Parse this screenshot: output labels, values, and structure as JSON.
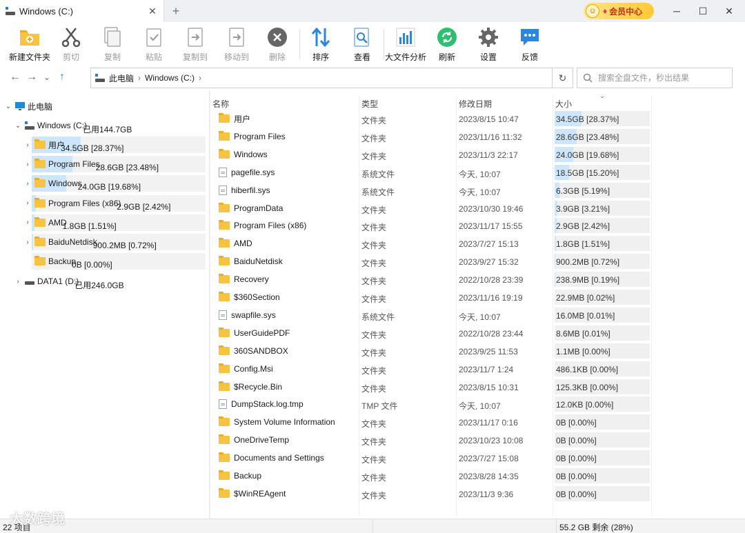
{
  "window": {
    "tab_title": "Windows (C:)",
    "tab_close": "✕",
    "new_tab": "+",
    "vip_label": "会员中心",
    "minimize": "─",
    "maximize": "☐",
    "close": "✕"
  },
  "toolbar": {
    "items": [
      {
        "label": "新建文件夹",
        "icon": "new-folder-icon",
        "enabled": true
      },
      {
        "label": "剪切",
        "icon": "scissors-icon",
        "enabled": false
      },
      {
        "label": "复制",
        "icon": "copy-icon",
        "enabled": false
      },
      {
        "label": "粘贴",
        "icon": "paste-icon",
        "enabled": false
      },
      {
        "label": "复制到",
        "icon": "copy-to-icon",
        "enabled": false
      },
      {
        "label": "移动到",
        "icon": "move-to-icon",
        "enabled": false
      },
      {
        "label": "删除",
        "icon": "delete-icon",
        "enabled": false
      },
      {
        "label": "排序",
        "icon": "sort-icon",
        "enabled": true
      },
      {
        "label": "查看",
        "icon": "view-icon",
        "enabled": true
      },
      {
        "label": "大文件分析",
        "icon": "chart-icon",
        "enabled": true
      },
      {
        "label": "刷新",
        "icon": "refresh-icon",
        "enabled": true
      },
      {
        "label": "设置",
        "icon": "gear-icon",
        "enabled": true
      },
      {
        "label": "反馈",
        "icon": "feedback-icon",
        "enabled": true
      }
    ]
  },
  "address": {
    "crumbs": [
      "此电脑",
      "Windows (C:)"
    ],
    "search_placeholder": "搜索全盘文件，秒出结果"
  },
  "tree": {
    "root": "此电脑",
    "drive_c": {
      "name": "Windows (C:)",
      "size": "已用144.7GB"
    },
    "children": [
      {
        "name": "用户",
        "size": "34.5GB [28.37%]",
        "pct": 28.37
      },
      {
        "name": "Program Files",
        "size": "28.6GB [23.48%]",
        "pct": 23.48
      },
      {
        "name": "Windows",
        "size": "24.0GB [19.68%]",
        "pct": 19.68
      },
      {
        "name": "Program Files (x86)",
        "size": "2.9GB [2.42%]",
        "pct": 2.42
      },
      {
        "name": "AMD",
        "size": "1.8GB [1.51%]",
        "pct": 1.51
      },
      {
        "name": "BaiduNetdisk",
        "size": "900.2MB [0.72%]",
        "pct": 0.72
      },
      {
        "name": "Backup",
        "size": "0B [0.00%]",
        "pct": 0
      }
    ],
    "drive_d": {
      "name": "DATA1 (D:)",
      "size": "已用246.0GB"
    }
  },
  "columns": {
    "name": "名称",
    "type": "类型",
    "date": "修改日期",
    "size": "大小"
  },
  "files": [
    {
      "name": "用户",
      "type": "文件夹",
      "date": "2023/8/15 10:47",
      "size": "34.5GB [28.37%]",
      "pct": 28.37,
      "icon": "folder"
    },
    {
      "name": "Program Files",
      "type": "文件夹",
      "date": "2023/11/16 11:32",
      "size": "28.6GB [23.48%]",
      "pct": 23.48,
      "icon": "folder"
    },
    {
      "name": "Windows",
      "type": "文件夹",
      "date": "2023/11/3 22:17",
      "size": "24.0GB [19.68%]",
      "pct": 19.68,
      "icon": "folder"
    },
    {
      "name": "pagefile.sys",
      "type": "系统文件",
      "date": "今天, 10:07",
      "size": "18.5GB [15.20%]",
      "pct": 15.2,
      "icon": "file"
    },
    {
      "name": "hiberfil.sys",
      "type": "系统文件",
      "date": "今天, 10:07",
      "size": "6.3GB [5.19%]",
      "pct": 5.19,
      "icon": "file"
    },
    {
      "name": "ProgramData",
      "type": "文件夹",
      "date": "2023/10/30 19:46",
      "size": "3.9GB [3.21%]",
      "pct": 3.21,
      "icon": "folder"
    },
    {
      "name": "Program Files (x86)",
      "type": "文件夹",
      "date": "2023/11/17 15:55",
      "size": "2.9GB [2.42%]",
      "pct": 2.42,
      "icon": "folder"
    },
    {
      "name": "AMD",
      "type": "文件夹",
      "date": "2023/7/27 15:13",
      "size": "1.8GB [1.51%]",
      "pct": 1.51,
      "icon": "folder"
    },
    {
      "name": "BaiduNetdisk",
      "type": "文件夹",
      "date": "2023/9/27 15:32",
      "size": "900.2MB [0.72%]",
      "pct": 0.72,
      "icon": "folder"
    },
    {
      "name": "Recovery",
      "type": "文件夹",
      "date": "2022/10/28 23:39",
      "size": "238.9MB [0.19%]",
      "pct": 0.19,
      "icon": "folder"
    },
    {
      "name": "$360Section",
      "type": "文件夹",
      "date": "2023/11/16 19:19",
      "size": "22.9MB [0.02%]",
      "pct": 0.02,
      "icon": "folder"
    },
    {
      "name": "swapfile.sys",
      "type": "系统文件",
      "date": "今天, 10:07",
      "size": "16.0MB [0.01%]",
      "pct": 0.01,
      "icon": "file"
    },
    {
      "name": "UserGuidePDF",
      "type": "文件夹",
      "date": "2022/10/28 23:44",
      "size": "8.6MB [0.01%]",
      "pct": 0.01,
      "icon": "folder"
    },
    {
      "name": "360SANDBOX",
      "type": "文件夹",
      "date": "2023/9/25 11:53",
      "size": "1.1MB [0.00%]",
      "pct": 0,
      "icon": "folder"
    },
    {
      "name": "Config.Msi",
      "type": "文件夹",
      "date": "2023/11/7 1:24",
      "size": "486.1KB [0.00%]",
      "pct": 0,
      "icon": "folder"
    },
    {
      "name": "$Recycle.Bin",
      "type": "文件夹",
      "date": "2023/8/15 10:31",
      "size": "125.3KB [0.00%]",
      "pct": 0,
      "icon": "folder"
    },
    {
      "name": "DumpStack.log.tmp",
      "type": "TMP 文件",
      "date": "今天, 10:07",
      "size": "12.0KB [0.00%]",
      "pct": 0,
      "icon": "file"
    },
    {
      "name": "System Volume Information",
      "type": "文件夹",
      "date": "2023/11/17 0:16",
      "size": "0B [0.00%]",
      "pct": 0,
      "icon": "folder"
    },
    {
      "name": "OneDriveTemp",
      "type": "文件夹",
      "date": "2023/10/23 10:08",
      "size": "0B [0.00%]",
      "pct": 0,
      "icon": "folder"
    },
    {
      "name": "Documents and Settings",
      "type": "文件夹",
      "date": "2023/7/27 15:08",
      "size": "0B [0.00%]",
      "pct": 0,
      "icon": "folder"
    },
    {
      "name": "Backup",
      "type": "文件夹",
      "date": "2023/8/28 14:35",
      "size": "0B [0.00%]",
      "pct": 0,
      "icon": "folder"
    },
    {
      "name": "$WinREAgent",
      "type": "文件夹",
      "date": "2023/11/3 9:36",
      "size": "0B [0.00%]",
      "pct": 0,
      "icon": "folder"
    }
  ],
  "status": {
    "count": "22 项目",
    "free": "55.2 GB 剩余 (28%)",
    "watermark": "大数跨境"
  }
}
